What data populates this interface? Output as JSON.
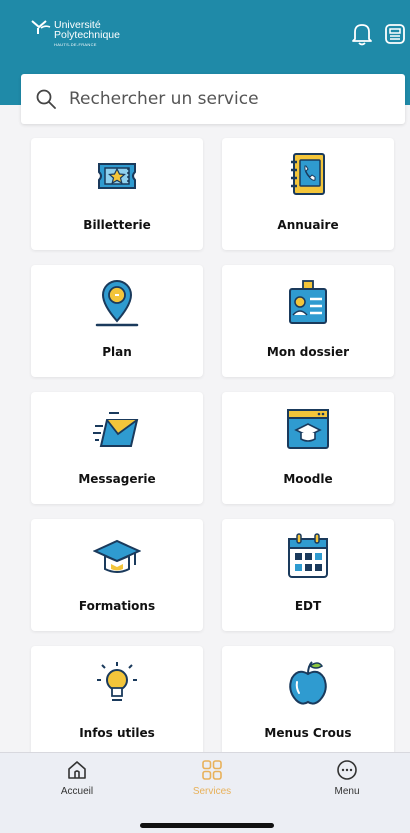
{
  "header": {
    "logo": {
      "line1": "Université",
      "line2": "Polytechnique",
      "line3": "HAUTS-DE-FRANCE"
    },
    "icons": [
      "bell-icon",
      "newspaper-icon"
    ]
  },
  "search": {
    "placeholder": "Rechercher un service",
    "icon": "search-icon"
  },
  "services": [
    {
      "label": "Billetterie",
      "icon": "ticket-icon"
    },
    {
      "label": "Annuaire",
      "icon": "phonebook-icon"
    },
    {
      "label": "Plan",
      "icon": "map-pin-icon"
    },
    {
      "label": "Mon dossier",
      "icon": "id-badge-icon"
    },
    {
      "label": "Messagerie",
      "icon": "mail-icon"
    },
    {
      "label": "Moodle",
      "icon": "moodle-browser-icon"
    },
    {
      "label": "Formations",
      "icon": "graduation-cap-icon"
    },
    {
      "label": "EDT",
      "icon": "calendar-icon"
    },
    {
      "label": "Infos utiles",
      "icon": "lightbulb-icon"
    },
    {
      "label": "Menus Crous",
      "icon": "apple-icon"
    }
  ],
  "tabbar": {
    "items": [
      {
        "label": "Accueil",
        "icon": "home-icon"
      },
      {
        "label": "Services",
        "icon": "grid-icon",
        "active": true
      },
      {
        "label": "Menu",
        "icon": "more-circle-icon"
      }
    ]
  },
  "colors": {
    "header": "#1f8aa8",
    "icon_blue": "#2f9bd0",
    "icon_yellow": "#f3c53a",
    "icon_dark": "#1a3a5c",
    "active_tab": "#e8b15a"
  }
}
